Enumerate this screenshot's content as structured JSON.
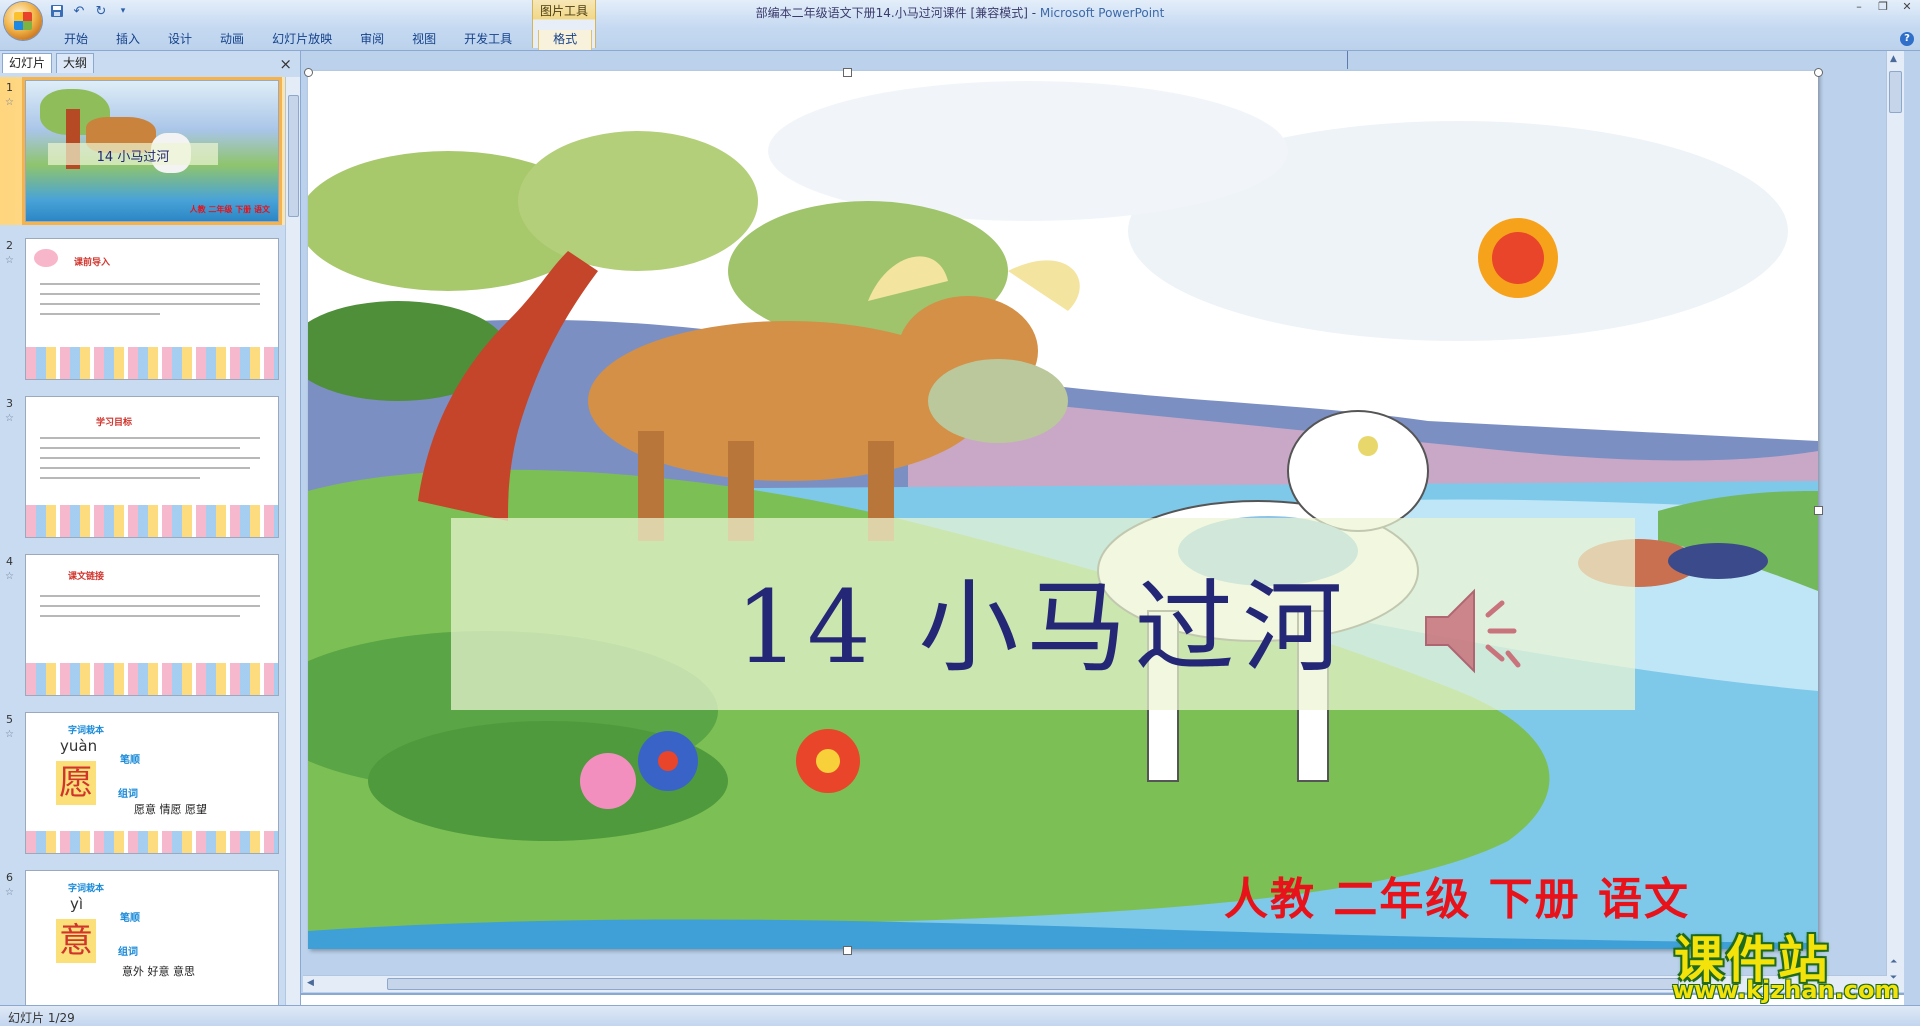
{
  "window": {
    "title": "部编本二年级语文下册14.小马过河课件 [兼容模式] - ",
    "app_name": "Microsoft PowerPoint"
  },
  "context_tab_group": "图片工具",
  "ribbon_tabs": [
    "开始",
    "插入",
    "设计",
    "动画",
    "幻灯片放映",
    "审阅",
    "视图",
    "开发工具"
  ],
  "context_tab": "格式",
  "left_pane": {
    "tabs": [
      "幻灯片",
      "大纲"
    ],
    "close_glyph": "×",
    "thumbnails": [
      {
        "num": "1",
        "title": "14 小马过河",
        "subtitle": "人教 二年级 下册 语文"
      },
      {
        "num": "2",
        "title": "课前导入"
      },
      {
        "num": "3",
        "title": "学习目标"
      },
      {
        "num": "4",
        "title": "课文链接"
      },
      {
        "num": "5",
        "title": "字词栽本",
        "pinyin": "yuàn",
        "char": "愿",
        "label1": "笔顺",
        "label2": "组词",
        "words": "愿意  情愿  愿望"
      },
      {
        "num": "6",
        "title": "字词栽本",
        "pinyin": "yì",
        "char": "意",
        "label1": "笔顺",
        "label2": "组词",
        "words": "意外  好意  意思"
      }
    ]
  },
  "slide": {
    "title": "14 小马过河",
    "subtitle": "人教 二年级 下册 语文",
    "colors": {
      "title": "#242775",
      "subtitle": "#e8121a"
    }
  },
  "status": {
    "text": "幻灯片 1/29"
  },
  "watermark": {
    "main": "课件站",
    "url": "www.kjzhan.com"
  },
  "icons": [
    "office-button-icon",
    "save-icon",
    "undo-icon",
    "redo-icon",
    "help-icon",
    "speaker-icon"
  ]
}
